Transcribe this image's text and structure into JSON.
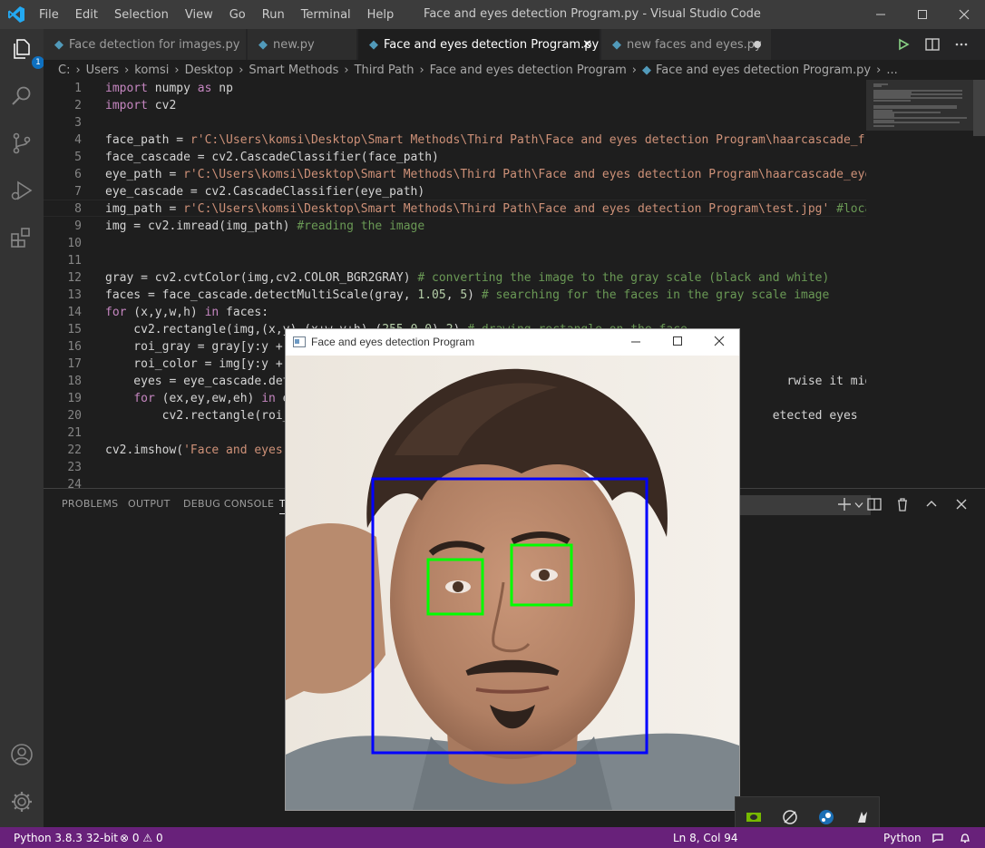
{
  "menu": [
    "File",
    "Edit",
    "Selection",
    "View",
    "Go",
    "Run",
    "Terminal",
    "Help"
  ],
  "window_title": "Face and eyes detection Program.py - Visual Studio Code",
  "activity": {
    "explorer_badge": "1"
  },
  "tabs": [
    {
      "label": "Face detection for images.py",
      "state": "normal"
    },
    {
      "label": "new.py",
      "state": "normal"
    },
    {
      "label": "Face and eyes detection Program.py",
      "state": "active"
    },
    {
      "label": "new faces and eyes.py",
      "state": "modified"
    }
  ],
  "breadcrumb": [
    "C:",
    "Users",
    "komsi",
    "Desktop",
    "Smart Methods",
    "Third Path",
    "Face and eyes detection Program",
    "Face and eyes detection Program.py",
    "..."
  ],
  "editor": {
    "line_numbers": [
      "1",
      "2",
      "3",
      "4",
      "5",
      "6",
      "7",
      "8",
      "9",
      "10",
      "11",
      "12",
      "13",
      "14",
      "15",
      "16",
      "17",
      "18",
      "19",
      "20",
      "21",
      "22",
      "23",
      "24"
    ],
    "lines": [
      "import numpy as np",
      "import cv2",
      "",
      "face_path = r'C:\\Users\\komsi\\Desktop\\Smart Methods\\Third Path\\Face and eyes detection Program\\haarcascade_fro",
      "face_cascade = cv2.CascadeClassifier(face_path)",
      "eye_path = r'C:\\Users\\komsi\\Desktop\\Smart Methods\\Third Path\\Face and eyes detection Program\\haarcascade_eye.",
      "eye_cascade = cv2.CascadeClassifier(eye_path)",
      "img_path = r'C:\\Users\\komsi\\Desktop\\Smart Methods\\Third Path\\Face and eyes detection Program\\test.jpg' #locat",
      "img = cv2.imread(img_path) #reading the image",
      "",
      "",
      "gray = cv2.cvtColor(img,cv2.COLOR_BGR2GRAY) # converting the image to the gray scale (black and white)",
      "faces = face_cascade.detectMultiScale(gray, 1.05, 5) # searching for the faces in the gray scale image",
      "for (x,y,w,h) in faces:",
      "    cv2.rectangle(img,(x,y),(x+w,y+h),(255,0,0),2) # drawing rectangle on the face",
      "    roi_gray = gray[y:y +",
      "    roi_color = img[y:y +",
      "    eyes = eye_cascade.det                                                                      rwise it might det",
      "    for (ex,ey,ew,eh) in e",
      "        cv2.rectangle(roi_                                                                    etected eyes",
      "",
      "cv2.imshow('Face and eyes",
      "",
      ""
    ]
  },
  "panel": {
    "tabs": [
      "PROBLEMS",
      "OUTPUT",
      "DEBUG CONSOLE",
      "T"
    ]
  },
  "popup": {
    "title": "Face and eyes detection Program"
  },
  "status": {
    "python": "Python 3.8.3 32-bit",
    "errors": "0",
    "warnings": "0",
    "position": "Ln 8, Col 94",
    "language": "Python"
  },
  "colors": {
    "statusbar": "#68217a",
    "face_box": "#0000ff",
    "eye_box": "#00ff00"
  }
}
